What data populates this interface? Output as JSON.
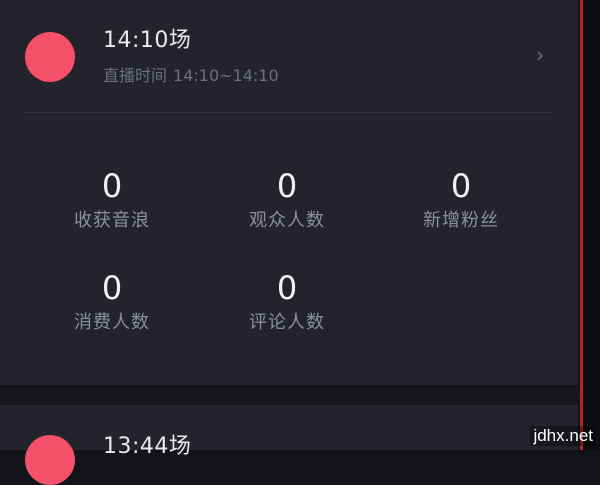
{
  "sessions": [
    {
      "title": "14:10场",
      "time_label": "直播时间",
      "time_range": "14:10~14:10",
      "chevron_icon": "chevron-right-icon",
      "stats": [
        {
          "value": "0",
          "label": "收获音浪"
        },
        {
          "value": "0",
          "label": "观众人数"
        },
        {
          "value": "0",
          "label": "新增粉丝"
        },
        {
          "value": "0",
          "label": "消费人数"
        },
        {
          "value": "0",
          "label": "评论人数"
        }
      ]
    },
    {
      "title": "13:44场"
    }
  ],
  "watermark": "jdhx.net",
  "colors": {
    "avatar": "#f4506a",
    "card_background": "#23242b",
    "page_background": "#15161c",
    "accent_rail": "#b3232b"
  }
}
